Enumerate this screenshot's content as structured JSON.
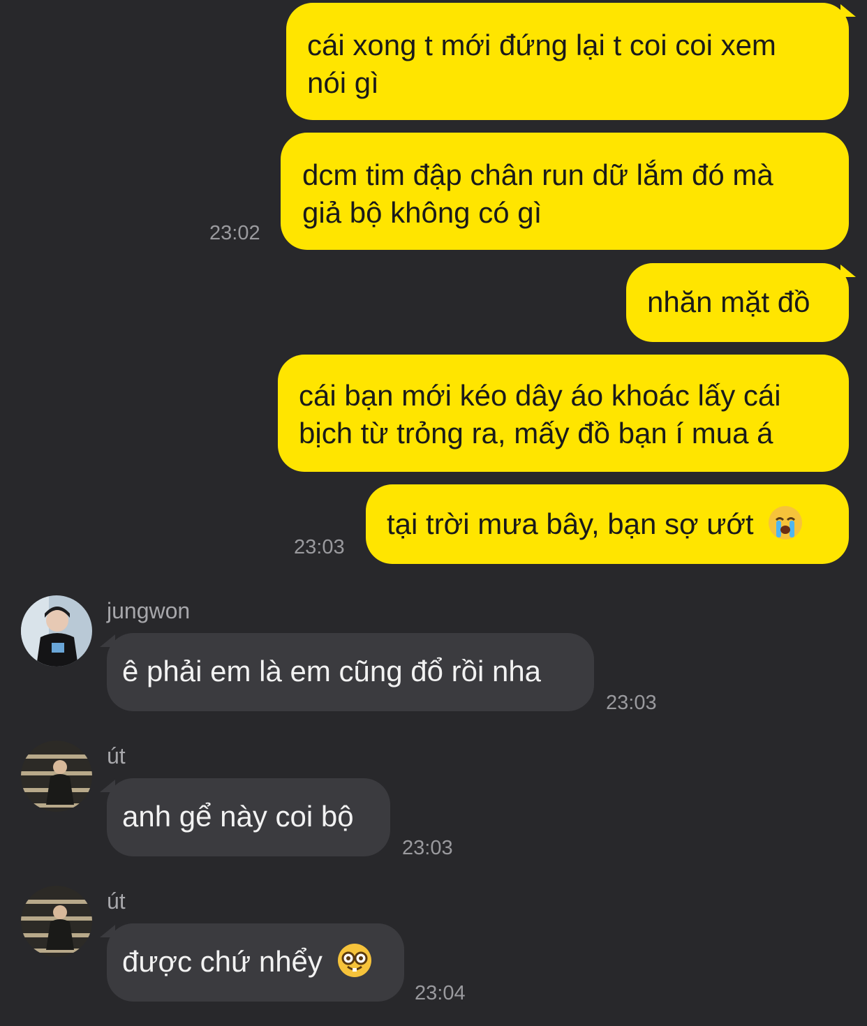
{
  "messages": [
    {
      "text_line1": "cái xong t mới đứng lại t coi coi xem",
      "text_line2": "nói gì"
    },
    {
      "text_line1": "dcm tim đập chân run dữ lắm đó mà",
      "text_line2": "giả bộ không có gì",
      "time": "23:02"
    },
    {
      "text": "nhăn mặt đồ"
    },
    {
      "text_line1": "cái bạn mới kéo dây áo khoác lấy cái",
      "text_line2": "bịch từ trỏng ra, mấy đồ bạn í mua á"
    },
    {
      "text": "tại trời mưa bây, bạn sợ ướt",
      "emoji": "loudly-crying-face",
      "time": "23:03"
    },
    {
      "sender": "jungwon",
      "text": "ê phải em là em cũng đổ rồi nha",
      "time": "23:03"
    },
    {
      "sender": "út",
      "text": "anh gể này coi bộ",
      "time": "23:03"
    },
    {
      "sender": "út",
      "text": "được chứ nhểy",
      "emoji": "nerd-face",
      "time": "23:04"
    }
  ],
  "colors": {
    "background": "#28282b",
    "outgoing_bubble": "#ffe500",
    "incoming_bubble": "#3b3b3f",
    "timestamp": "#9a9a9e"
  }
}
